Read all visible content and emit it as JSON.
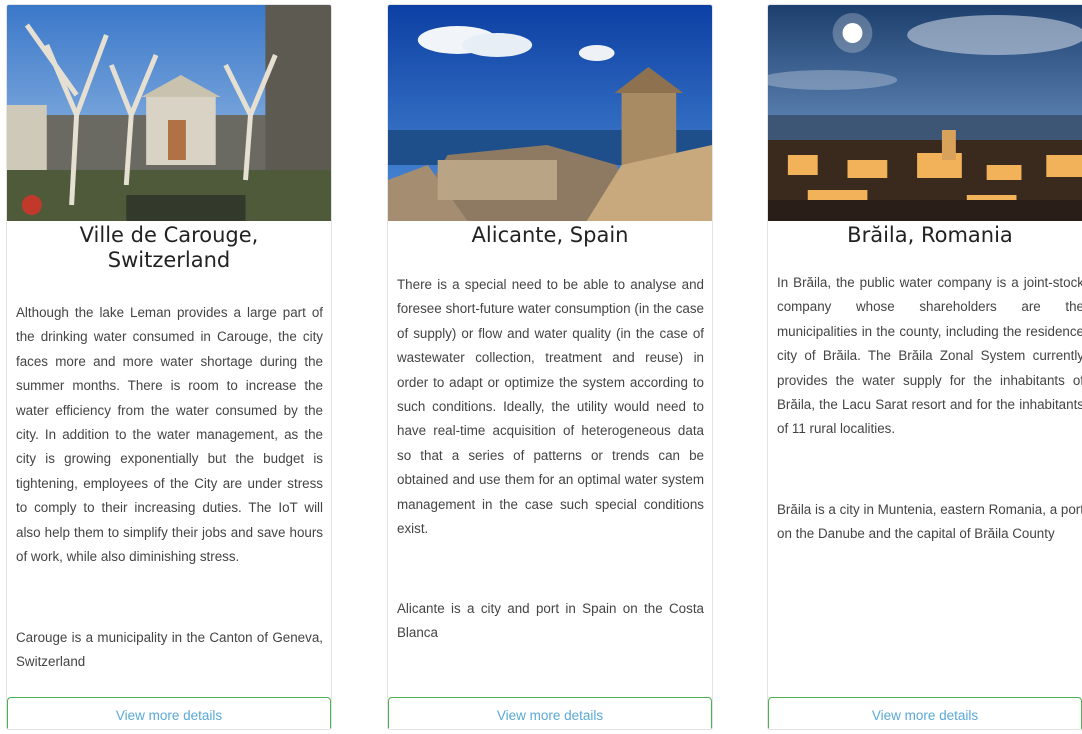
{
  "cards": [
    {
      "title": "Ville de Carouge, Switzerland",
      "description": "Although the lake Leman provides a large part of the drinking water consumed in Carouge, the city faces more and more water shortage during the summer months. There is room to increase the water efficiency from the water consumed by the city. In addition to the water management, as the city is growing exponentially but the budget is tightening, employees of the City are under stress to comply to their increasing duties. The IoT will also help them to simplify their jobs and save hours of work, while also diminishing stress.",
      "note": "Carouge is a municipality in the Canton of Geneva, Switzerland",
      "button": "View more details"
    },
    {
      "title": "Alicante, Spain",
      "description": "There is a special need to be able to analyse and foresee short-future water consumption (in the case of supply) or flow and water quality (in the case of wastewater collection, treatment and reuse) in order to adapt or optimize the system according to such conditions. Ideally, the utility would need to have real-time acquisition of heterogeneous data so that a series of patterns or trends can be obtained and use them for an optimal water system management in the case such special conditions exist.",
      "note": "Alicante is a city and port in Spain on the Costa Blanca",
      "button": "View more details"
    },
    {
      "title": "Brăila, Romania",
      "description": "In Brăila, the public water company is a joint-stock company whose shareholders are the municipalities in the county, including the residence city of Brăila. The Brăila Zonal System currently provides the water supply for the inhabitants of Brăila, the Lacu Sarat resort and for the inhabitants of 11 rural localities.",
      "note": "Brăila is a city in Muntenia, eastern Romania, a port on the Danube and the capital of Brăila County",
      "button": "View more details"
    }
  ],
  "colors": {
    "button_border": "#4caf50",
    "button_text": "#5aa9d6"
  }
}
